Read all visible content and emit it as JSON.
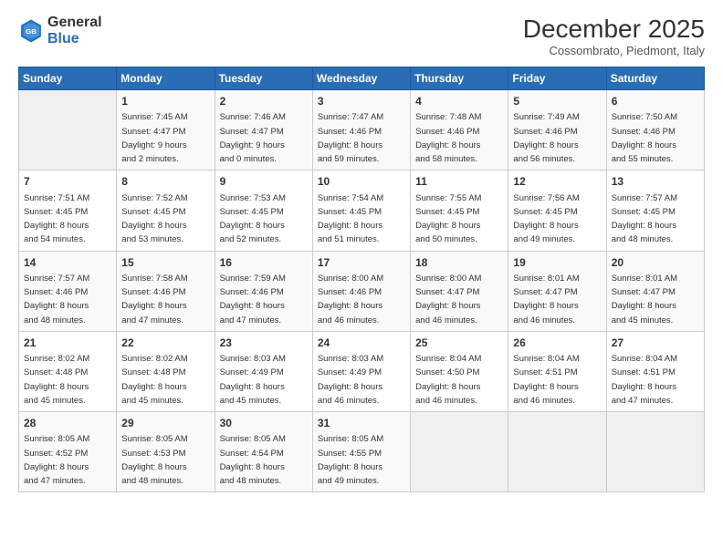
{
  "logo": {
    "line1": "General",
    "line2": "Blue"
  },
  "title": "December 2025",
  "location": "Cossombrato, Piedmont, Italy",
  "weekdays": [
    "Sunday",
    "Monday",
    "Tuesday",
    "Wednesday",
    "Thursday",
    "Friday",
    "Saturday"
  ],
  "weeks": [
    [
      {
        "day": "",
        "info": ""
      },
      {
        "day": "1",
        "info": "Sunrise: 7:45 AM\nSunset: 4:47 PM\nDaylight: 9 hours\nand 2 minutes."
      },
      {
        "day": "2",
        "info": "Sunrise: 7:46 AM\nSunset: 4:47 PM\nDaylight: 9 hours\nand 0 minutes."
      },
      {
        "day": "3",
        "info": "Sunrise: 7:47 AM\nSunset: 4:46 PM\nDaylight: 8 hours\nand 59 minutes."
      },
      {
        "day": "4",
        "info": "Sunrise: 7:48 AM\nSunset: 4:46 PM\nDaylight: 8 hours\nand 58 minutes."
      },
      {
        "day": "5",
        "info": "Sunrise: 7:49 AM\nSunset: 4:46 PM\nDaylight: 8 hours\nand 56 minutes."
      },
      {
        "day": "6",
        "info": "Sunrise: 7:50 AM\nSunset: 4:46 PM\nDaylight: 8 hours\nand 55 minutes."
      }
    ],
    [
      {
        "day": "7",
        "info": "Sunrise: 7:51 AM\nSunset: 4:45 PM\nDaylight: 8 hours\nand 54 minutes."
      },
      {
        "day": "8",
        "info": "Sunrise: 7:52 AM\nSunset: 4:45 PM\nDaylight: 8 hours\nand 53 minutes."
      },
      {
        "day": "9",
        "info": "Sunrise: 7:53 AM\nSunset: 4:45 PM\nDaylight: 8 hours\nand 52 minutes."
      },
      {
        "day": "10",
        "info": "Sunrise: 7:54 AM\nSunset: 4:45 PM\nDaylight: 8 hours\nand 51 minutes."
      },
      {
        "day": "11",
        "info": "Sunrise: 7:55 AM\nSunset: 4:45 PM\nDaylight: 8 hours\nand 50 minutes."
      },
      {
        "day": "12",
        "info": "Sunrise: 7:56 AM\nSunset: 4:45 PM\nDaylight: 8 hours\nand 49 minutes."
      },
      {
        "day": "13",
        "info": "Sunrise: 7:57 AM\nSunset: 4:45 PM\nDaylight: 8 hours\nand 48 minutes."
      }
    ],
    [
      {
        "day": "14",
        "info": "Sunrise: 7:57 AM\nSunset: 4:46 PM\nDaylight: 8 hours\nand 48 minutes."
      },
      {
        "day": "15",
        "info": "Sunrise: 7:58 AM\nSunset: 4:46 PM\nDaylight: 8 hours\nand 47 minutes."
      },
      {
        "day": "16",
        "info": "Sunrise: 7:59 AM\nSunset: 4:46 PM\nDaylight: 8 hours\nand 47 minutes."
      },
      {
        "day": "17",
        "info": "Sunrise: 8:00 AM\nSunset: 4:46 PM\nDaylight: 8 hours\nand 46 minutes."
      },
      {
        "day": "18",
        "info": "Sunrise: 8:00 AM\nSunset: 4:47 PM\nDaylight: 8 hours\nand 46 minutes."
      },
      {
        "day": "19",
        "info": "Sunrise: 8:01 AM\nSunset: 4:47 PM\nDaylight: 8 hours\nand 46 minutes."
      },
      {
        "day": "20",
        "info": "Sunrise: 8:01 AM\nSunset: 4:47 PM\nDaylight: 8 hours\nand 45 minutes."
      }
    ],
    [
      {
        "day": "21",
        "info": "Sunrise: 8:02 AM\nSunset: 4:48 PM\nDaylight: 8 hours\nand 45 minutes."
      },
      {
        "day": "22",
        "info": "Sunrise: 8:02 AM\nSunset: 4:48 PM\nDaylight: 8 hours\nand 45 minutes."
      },
      {
        "day": "23",
        "info": "Sunrise: 8:03 AM\nSunset: 4:49 PM\nDaylight: 8 hours\nand 45 minutes."
      },
      {
        "day": "24",
        "info": "Sunrise: 8:03 AM\nSunset: 4:49 PM\nDaylight: 8 hours\nand 46 minutes."
      },
      {
        "day": "25",
        "info": "Sunrise: 8:04 AM\nSunset: 4:50 PM\nDaylight: 8 hours\nand 46 minutes."
      },
      {
        "day": "26",
        "info": "Sunrise: 8:04 AM\nSunset: 4:51 PM\nDaylight: 8 hours\nand 46 minutes."
      },
      {
        "day": "27",
        "info": "Sunrise: 8:04 AM\nSunset: 4:51 PM\nDaylight: 8 hours\nand 47 minutes."
      }
    ],
    [
      {
        "day": "28",
        "info": "Sunrise: 8:05 AM\nSunset: 4:52 PM\nDaylight: 8 hours\nand 47 minutes."
      },
      {
        "day": "29",
        "info": "Sunrise: 8:05 AM\nSunset: 4:53 PM\nDaylight: 8 hours\nand 48 minutes."
      },
      {
        "day": "30",
        "info": "Sunrise: 8:05 AM\nSunset: 4:54 PM\nDaylight: 8 hours\nand 48 minutes."
      },
      {
        "day": "31",
        "info": "Sunrise: 8:05 AM\nSunset: 4:55 PM\nDaylight: 8 hours\nand 49 minutes."
      },
      {
        "day": "",
        "info": ""
      },
      {
        "day": "",
        "info": ""
      },
      {
        "day": "",
        "info": ""
      }
    ]
  ]
}
